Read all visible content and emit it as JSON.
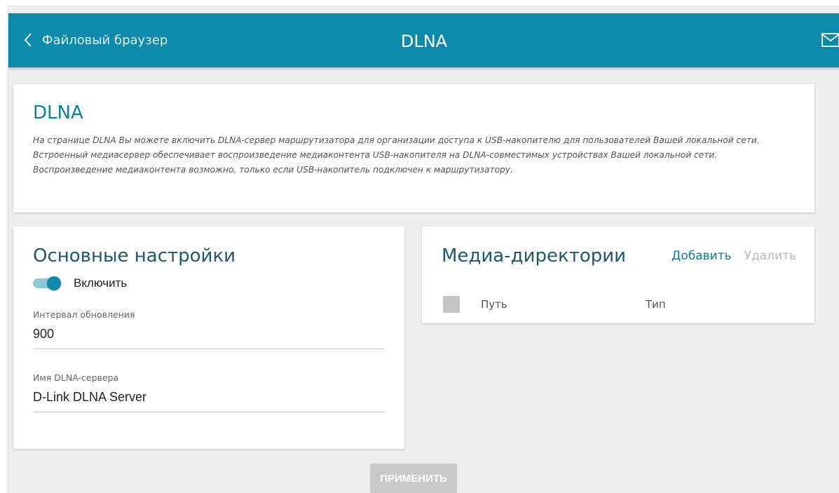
{
  "header": {
    "back_label": "Файловый браузер",
    "title": "DLNA",
    "icons": {
      "back": "chevron-left-icon",
      "mail": "mail-icon"
    },
    "colors": {
      "bar": "#0b8aab"
    }
  },
  "info": {
    "title": "DLNA",
    "lines": [
      "На странице DLNA Вы можете включить DLNA-сервер маршрутизатора для организации доступа к USB-накопителю для пользователей Вашей локальной сети.",
      "Встроенный медиасервер обеспечивает воспроизведение медиаконтента USB-накопителя на DLNA-совместимых устройствах Вашей локальной сети.",
      "Воспроизведение медиаконтента возможно, только если USB-накопитель подключен к маршрутизатору."
    ]
  },
  "basic": {
    "title": "Основные настройки",
    "enable_label": "Включить",
    "enabled": true,
    "interval_label": "Интервал обновления",
    "interval_value": "900",
    "server_name_label": "Имя DLNA-сервера",
    "server_name_value": "D-Link DLNA Server"
  },
  "media": {
    "title": "Медиа-директории",
    "add_label": "Добавить",
    "delete_label": "Удалить",
    "columns": [
      "Путь",
      "Тип"
    ],
    "rows": []
  },
  "apply_label": "ПРИМЕНИТЬ",
  "colors": {
    "accent": "#0b8aab",
    "link": "#0b7c9c",
    "disabled": "#c9c9c9"
  }
}
